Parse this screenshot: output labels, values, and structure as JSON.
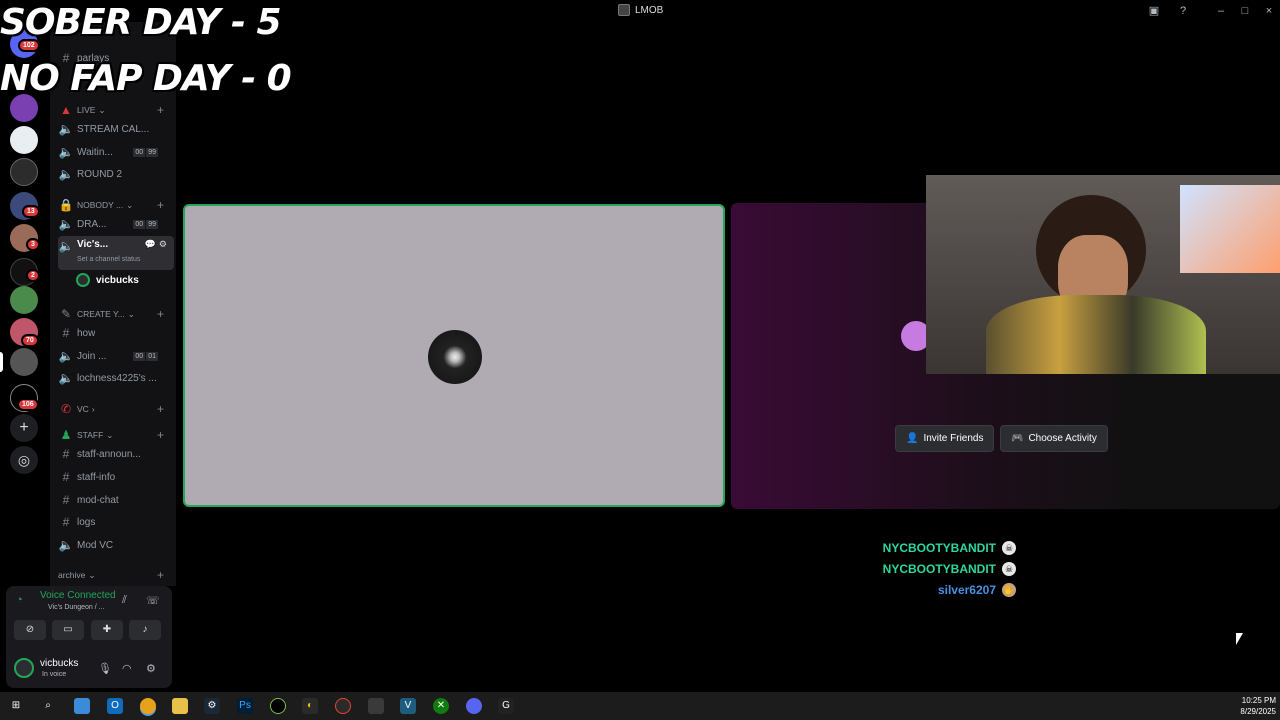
{
  "window": {
    "title": "LMOB"
  },
  "overlay": {
    "line1": "SOBER DAY - 5",
    "line2": "NO FAP DAY - 0"
  },
  "server_badges": [
    "102",
    "13",
    "3",
    "2",
    "70",
    "106"
  ],
  "channels": {
    "items": [
      {
        "type": "text",
        "label": "parlays"
      },
      {
        "type": "category",
        "label": "LIVE"
      },
      {
        "type": "voice",
        "label": "STREAM CAL..."
      },
      {
        "type": "voice",
        "label": "Waitin...",
        "limit": [
          "00",
          "99"
        ]
      },
      {
        "type": "voice",
        "label": "ROUND 2"
      },
      {
        "type": "category",
        "label": "NOBODY ..."
      },
      {
        "type": "voice",
        "label": "DRA...",
        "limit": [
          "00",
          "99"
        ]
      },
      {
        "type": "voice",
        "label": "Vic's..."
      },
      {
        "type": "category",
        "label": "CREATE Y..."
      },
      {
        "type": "text",
        "label": "how"
      },
      {
        "type": "voice",
        "label": "Join ...",
        "limit": [
          "00",
          "01"
        ]
      },
      {
        "type": "voice",
        "label": "lochness4225's ..."
      },
      {
        "type": "category",
        "label": "VC"
      },
      {
        "type": "category",
        "label": "STAFF"
      },
      {
        "type": "text",
        "label": "staff-announ..."
      },
      {
        "type": "text",
        "label": "staff-info"
      },
      {
        "type": "text",
        "label": "mod-chat"
      },
      {
        "type": "text",
        "label": "logs"
      },
      {
        "type": "voice",
        "label": "Mod VC"
      },
      {
        "type": "category",
        "label": "archive"
      }
    ],
    "channel_status": "Set a channel status",
    "voice_member": "vicbucks"
  },
  "voice_panel": {
    "status": "Voice Connected",
    "location": "Vic's Dungeon / ..."
  },
  "user": {
    "name": "vicbucks",
    "status": "In voice"
  },
  "stage": {
    "invite_label": "Invite Friends",
    "activity_label": "Choose Activity"
  },
  "chat": [
    {
      "user": "NYCBOOTYBANDIT",
      "color": "#2fd6a0"
    },
    {
      "user": "NYCBOOTYBANDIT",
      "color": "#2fd6a0"
    },
    {
      "user": "silver6207",
      "color": "#4a90e2"
    }
  ],
  "clock": {
    "time": "10:25 PM",
    "date": "8/29/2025"
  }
}
